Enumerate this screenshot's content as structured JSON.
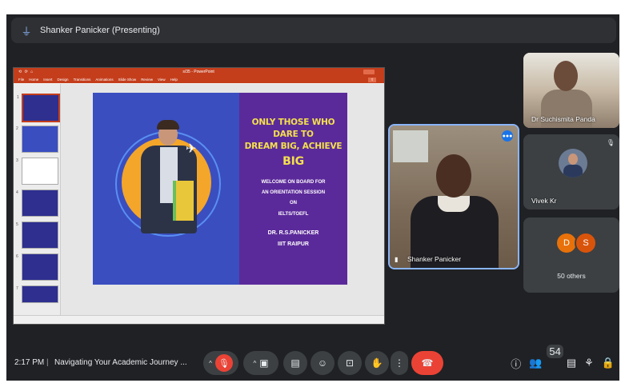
{
  "top_bar": {
    "title": "Shanker Panicker (Presenting)"
  },
  "ppt": {
    "doc_title": "s/35 - PowerPoint",
    "ribbon_tabs": [
      "File",
      "Home",
      "Insert",
      "Design",
      "Transitions",
      "Animations",
      "Slide Show",
      "Review",
      "View",
      "Help"
    ],
    "slide": {
      "headline_line1": "ONLY THOSE WHO DARE TO",
      "headline_line2a": "DREAM BIG, ACHIEVE ",
      "headline_line2b": "BIG",
      "welcome_line1": "WELCOME ON BOARD FOR",
      "welcome_line2": "AN ORIENTATION SESSION",
      "welcome_line3": "ON",
      "welcome_line4": "IELTS/TOEFL",
      "author_name": "DR. R.S.PANICKER",
      "author_org": "IIIT RAIPUR"
    }
  },
  "participants": {
    "main": "Shanker Panicker",
    "r1": "Dr Suchismita Panda",
    "r2": "Vivek Kr",
    "others_chips": [
      "D",
      "S"
    ],
    "others_label": "50 others"
  },
  "bottom": {
    "time": "2:17 PM",
    "separator": "|",
    "meeting_title": "Navigating Your Academic Journey ...",
    "people_count": "54"
  },
  "icons": {
    "mic": "mic-off-icon",
    "camera": "camera-icon",
    "captions": "captions-icon",
    "emoji": "emoji-icon",
    "present": "present-icon",
    "hand": "hand-icon",
    "more": "more-icon",
    "end": "end-call-icon",
    "info": "info-icon",
    "people": "people-icon",
    "chat": "chat-icon",
    "activities": "activities-icon",
    "lock": "lock-icon"
  },
  "colors": {
    "accent": "#8ab4f8",
    "end_call": "#ea4335",
    "ppt_red": "#c43e1c",
    "chip": "#e8710a"
  }
}
